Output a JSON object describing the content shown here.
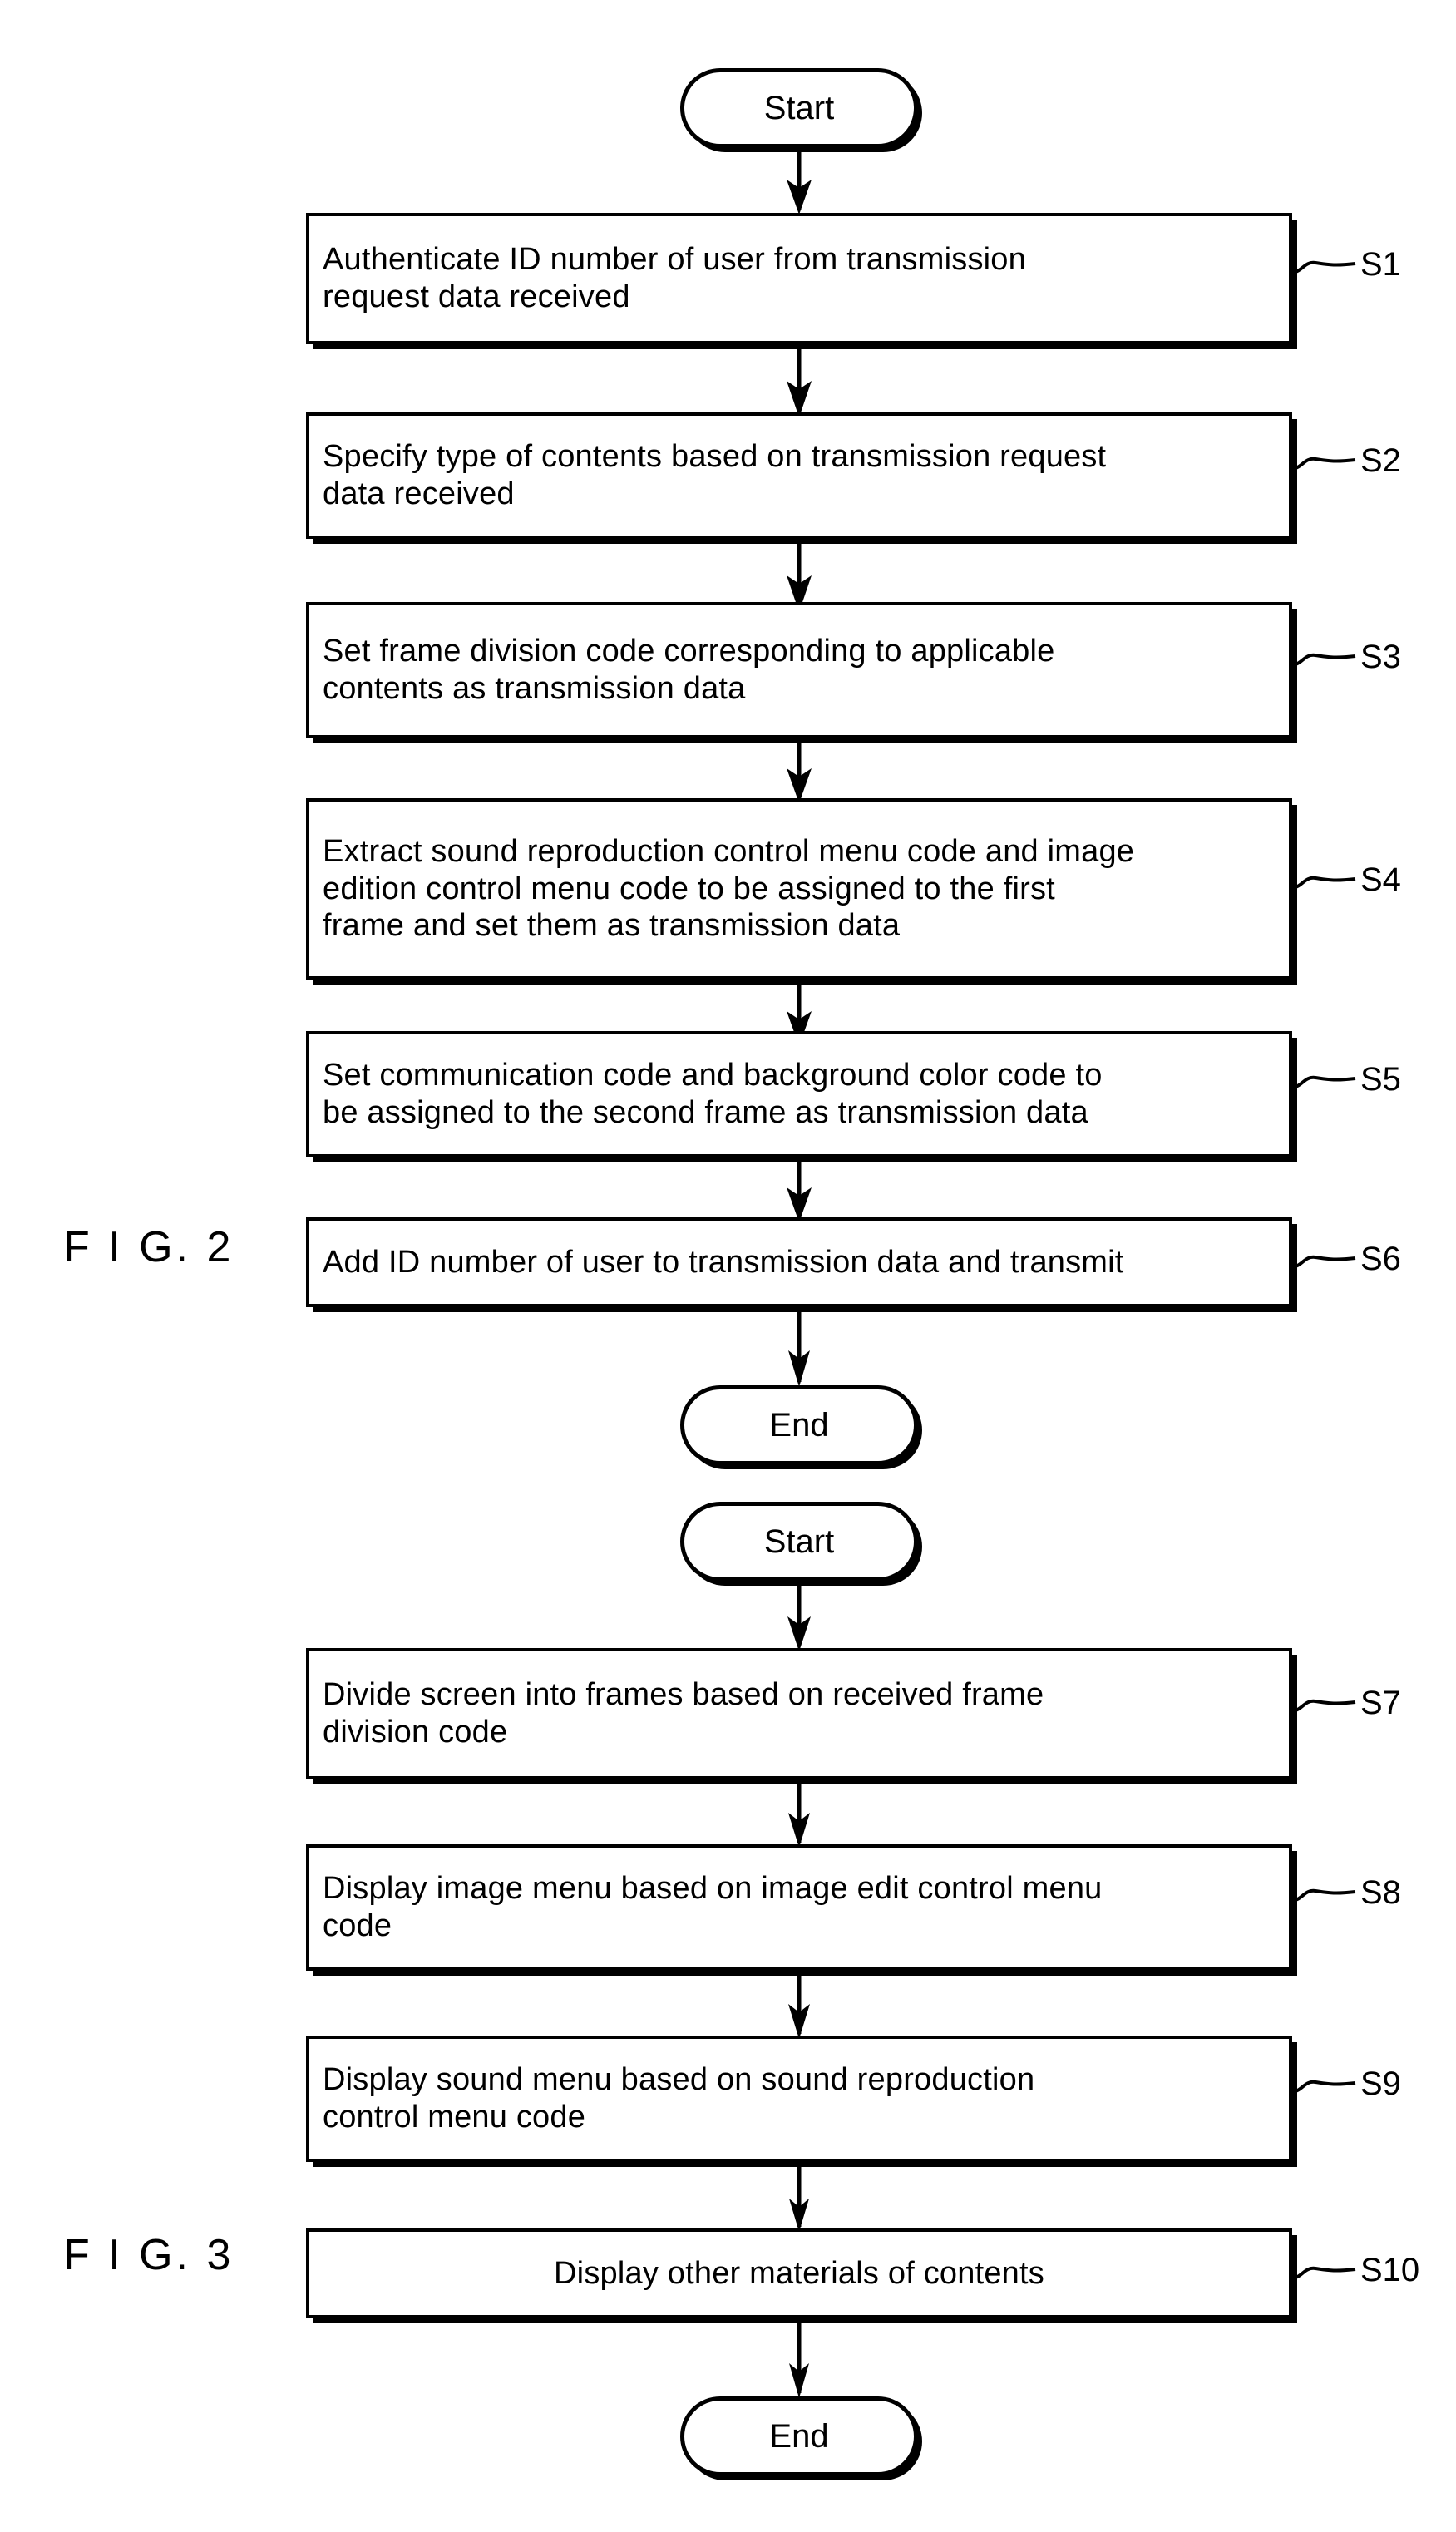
{
  "figure": {
    "fig2_label": "F I G. 2",
    "fig3_label": "F I G. 3"
  },
  "flow_fig2": {
    "start_label": "Start",
    "end_label": "End",
    "steps": [
      {
        "ref": "S1",
        "text": "Authenticate ID number of user from transmission\nrequest data received",
        "align": "left"
      },
      {
        "ref": "S2",
        "text": "Specify type of contents based on transmission request\ndata received",
        "align": "left"
      },
      {
        "ref": "S3",
        "text": "Set frame  division code corresponding to applicable\ncontents as transmission data",
        "align": "left"
      },
      {
        "ref": "S4",
        "text": "Extract sound reproduction control menu code and image\nedition control menu code to be assigned to the first\nframe and set them as transmission data",
        "align": "left"
      },
      {
        "ref": "S5",
        "text": "Set communication code and background color code to\nbe assigned to the second frame as transmission data",
        "align": "left"
      },
      {
        "ref": "S6",
        "text": "Add ID number of user to transmission data and transmit",
        "align": "left"
      }
    ]
  },
  "flow_fig3": {
    "start_label": "Start",
    "end_label": "End",
    "steps": [
      {
        "ref": "S7",
        "text": "Divide screen into frames based on received frame\ndivision code",
        "align": "left"
      },
      {
        "ref": "S8",
        "text": "Display image menu based on image edit control menu\ncode",
        "align": "left"
      },
      {
        "ref": "S9",
        "text": "Display sound menu based on sound reproduction\ncontrol menu code",
        "align": "left"
      },
      {
        "ref": "S10",
        "text": "Display other materials of contents",
        "align": "center"
      }
    ]
  },
  "colors": {
    "ink": "#000000",
    "paper": "#ffffff"
  }
}
